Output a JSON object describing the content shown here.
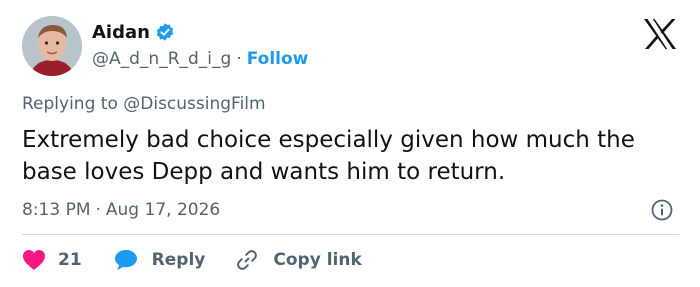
{
  "author": {
    "name": "Aidan",
    "handle": "@A_d_n_R_d_i_g",
    "separator": "·",
    "follow_label": "Follow",
    "verified_icon": "verified-badge-icon",
    "verified_color": "#1d9bf0"
  },
  "reply_context": {
    "prefix": "Replying to",
    "mention": "@DiscussingFilm"
  },
  "tweet": {
    "text": "Extremely bad choice especially given how much the base loves Depp and wants him to return.",
    "time": "8:13 PM",
    "separator": "·",
    "date": "Aug 17, 2026"
  },
  "actions": {
    "like_count": "21",
    "like_color": "#f91880",
    "reply_label": "Reply",
    "reply_color": "#1d9bf0",
    "copy_label": "Copy link"
  },
  "colors": {
    "text": "#0f1419",
    "muted": "#536471",
    "accent": "#1d9bf0",
    "divider": "#cfd9de"
  }
}
